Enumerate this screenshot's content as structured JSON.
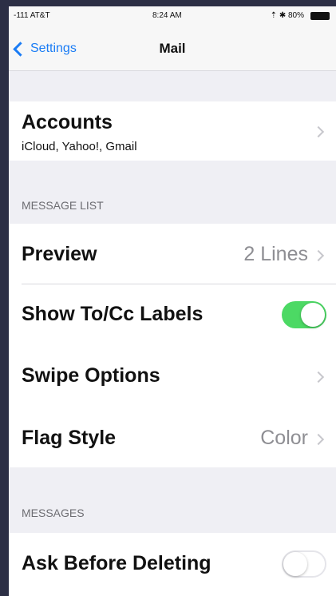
{
  "status_bar": {
    "carrier": "-111 AT&T",
    "time": "8:24 AM",
    "right": "⇡ ✱ 80%"
  },
  "nav": {
    "back_label": "Settings",
    "title": "Mail"
  },
  "accounts": {
    "label": "Accounts",
    "detail": "iCloud, Yahoo!, Gmail"
  },
  "message_list": {
    "header": "MESSAGE LIST",
    "preview_label": "Preview",
    "preview_value": "2 Lines",
    "show_labels_label": "Show To/Cc Labels",
    "show_labels_on": true,
    "swipe_label": "Swipe Options",
    "flag_label": "Flag Style",
    "flag_value": "Color"
  },
  "messages": {
    "header": "MESSAGES",
    "ask_label": "Ask Before Deleting",
    "ask_on": false
  },
  "colors": {
    "accent": "#1a7cf5",
    "toggle_on": "#4cd964",
    "background": "#efeff4"
  }
}
